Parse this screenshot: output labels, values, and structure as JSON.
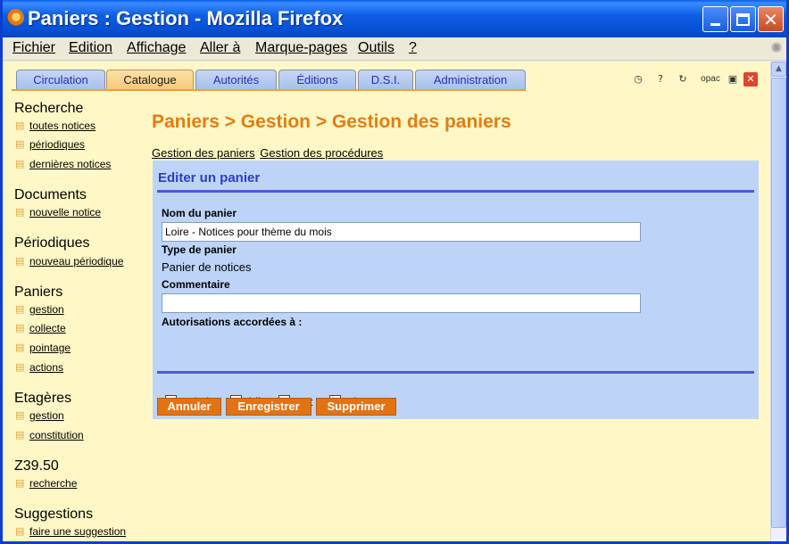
{
  "window": {
    "title": "Paniers : Gestion - Mozilla Firefox"
  },
  "menubar": {
    "items": [
      "Fichier",
      "Edition",
      "Affichage",
      "Aller à",
      "Marque-pages",
      "Outils",
      "?"
    ]
  },
  "tabs": [
    "Circulation",
    "Catalogue",
    "Autorités",
    "Éditions",
    "D.S.I.",
    "Administration"
  ],
  "active_tab": "Catalogue",
  "toolbar_icons": {
    "opac": "opac"
  },
  "nav": {
    "sections": [
      {
        "title": "Recherche",
        "links": [
          "toutes notices",
          "périodiques",
          "dernières notices"
        ]
      },
      {
        "title": "Documents",
        "links": [
          "nouvelle notice"
        ]
      },
      {
        "title": "Périodiques",
        "links": [
          "nouveau périodique"
        ]
      },
      {
        "title": "Paniers",
        "links": [
          "gestion",
          "collecte",
          "pointage",
          "actions"
        ]
      },
      {
        "title": "Etagères",
        "links": [
          "gestion",
          "constitution"
        ]
      },
      {
        "title": "Z39.50",
        "links": [
          "recherche"
        ]
      },
      {
        "title": "Suggestions",
        "links": [
          "faire une suggestion"
        ]
      }
    ]
  },
  "page": {
    "title": "Paniers > Gestion > Gestion des paniers",
    "sublinks": [
      "Gestion des paniers",
      "Gestion des procédures"
    ]
  },
  "form": {
    "title": "Editer un panier",
    "name_label": "Nom du panier",
    "name_value": "Loire - Notices pour thème du mois",
    "type_label": "Type de panier",
    "type_value": "Panier de notices",
    "comment_label": "Commentaire",
    "comment_value": "",
    "auth_label": "Autorisations accordées à :",
    "permissions": [
      {
        "label": "admin",
        "checked": true
      },
      {
        "label": "bib",
        "checked": true
      },
      {
        "label": "cat",
        "checked": false
      },
      {
        "label": "circ",
        "checked": false
      }
    ],
    "buttons": {
      "cancel": "Annuler",
      "save": "Enregistrer",
      "delete": "Supprimer"
    }
  }
}
